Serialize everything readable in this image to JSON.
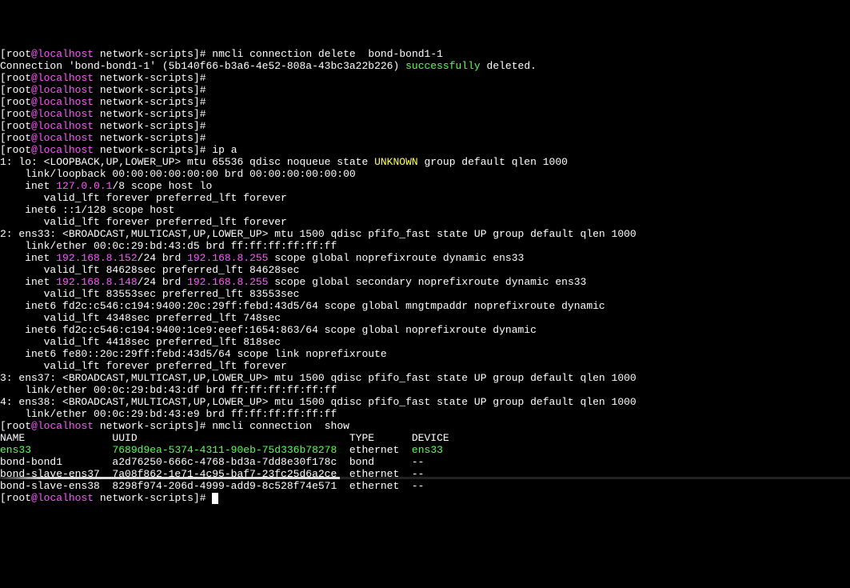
{
  "prompt": {
    "user": "root",
    "at": "@",
    "host": "localhost",
    "path": " network-scripts",
    "end": "]# "
  },
  "cmd1": "nmcli connection delete  bond-bond1-1",
  "conn_result": {
    "pre": "Connection 'bond-bond1-1' (5b140f66-b3a6-4e52-808a-43bc3a22b226) ",
    "status": "successfully",
    "post": " deleted."
  },
  "cmd_ipa": "ip a",
  "lo": {
    "head": "1: lo: <LOOPBACK,UP,LOWER_UP> mtu 65536 qdisc noqueue state ",
    "state": "UNKNOWN",
    "tail": " group default qlen 1000",
    "link": "    link/loopback 00:00:00:00:00:00 brd 00:00:00:00:00:00",
    "inet_pre": "    inet ",
    "inet_ip": "127.0.0.1",
    "inet_post": "/8 scope host lo",
    "valid1": "       valid_lft forever preferred_lft forever",
    "inet6": "    inet6 ::1/128 scope host ",
    "valid2": "       valid_lft forever preferred_lft forever"
  },
  "ens33": {
    "head": "2: ens33: <BROADCAST,MULTICAST,UP,LOWER_UP> mtu 1500 qdisc pfifo_fast state UP group default qlen 1000",
    "link": "    link/ether 00:0c:29:bd:43:d5 brd ff:ff:ff:ff:ff:ff",
    "inet1_pre": "    inet ",
    "inet1_ip": "192.168.8.152",
    "inet1_mid": "/24 brd ",
    "inet1_brd": "192.168.8.255",
    "inet1_post": " scope global noprefixroute dynamic ens33",
    "valid1": "       valid_lft 84628sec preferred_lft 84628sec",
    "inet2_pre": "    inet ",
    "inet2_ip": "192.168.8.148",
    "inet2_mid": "/24 brd ",
    "inet2_brd": "192.168.8.255",
    "inet2_post": " scope global secondary noprefixroute dynamic ens33",
    "valid2": "       valid_lft 83553sec preferred_lft 83553sec",
    "inet6a": "    inet6 fd2c:c546:c194:9400:20c:29ff:febd:43d5/64 scope global mngtmpaddr noprefixroute dynamic ",
    "valid3": "       valid_lft 4348sec preferred_lft 748sec",
    "inet6b": "    inet6 fd2c:c546:c194:9400:1ce9:eeef:1654:863/64 scope global noprefixroute dynamic ",
    "valid4": "       valid_lft 4418sec preferred_lft 818sec",
    "inet6c": "    inet6 fe80::20c:29ff:febd:43d5/64 scope link noprefixroute ",
    "valid5": "       valid_lft forever preferred_lft forever"
  },
  "ens37": {
    "head": "3: ens37: <BROADCAST,MULTICAST,UP,LOWER_UP> mtu 1500 qdisc pfifo_fast state UP group default qlen 1000",
    "link": "    link/ether 00:0c:29:bd:43:df brd ff:ff:ff:ff:ff:ff"
  },
  "ens38": {
    "head": "4: ens38: <BROADCAST,MULTICAST,UP,LOWER_UP> mtu 1500 qdisc pfifo_fast state UP group default qlen 1000",
    "link": "    link/ether 00:0c:29:bd:43:e9 brd ff:ff:ff:ff:ff:ff"
  },
  "cmd_show": "nmcli connection  show",
  "table": {
    "header": "NAME              UUID                                  TYPE      DEVICE ",
    "row1_name": "ens33",
    "row1_sp": "             ",
    "row1_uuid": "7689d9ea-5374-4311-90eb-75d336b78278",
    "row1_mid": "  ethernet  ",
    "row1_dev": "ens33",
    "row1_end": "  ",
    "row2": "bond-bond1        a2d76250-666c-4768-bd3a-7dd8e30f178c  bond      --     ",
    "row3": "bond-slave-ens37  7a08f862-1e71-4c95-baf7-23fc25d6a2ce  ethernet  --     ",
    "row4": "bond-slave-ens38  8298f974-206d-4999-add9-8c528f74e571  ethernet  --     "
  }
}
